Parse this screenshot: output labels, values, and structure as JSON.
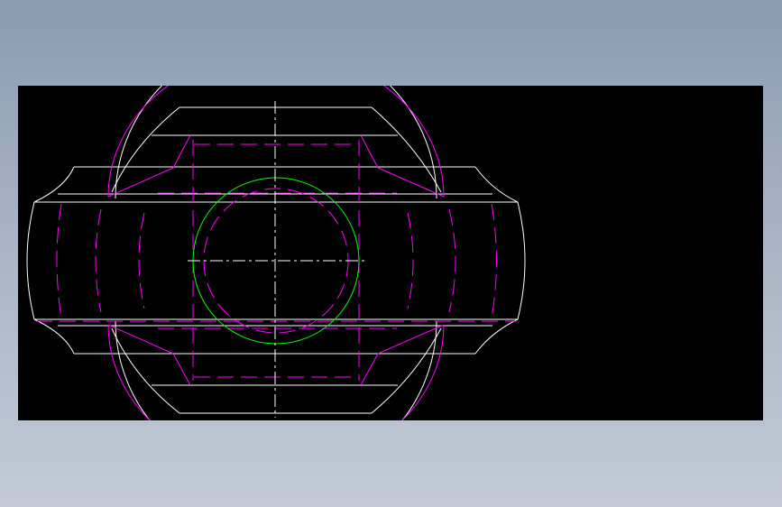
{
  "colors": {
    "background_outer": "#8a9bb0",
    "viewport_background": "#000000",
    "visible_edge": "#ffffff",
    "hidden_edge": "#ff00ff",
    "bore_circle": "#00ff00",
    "centerline": "#ffffff"
  },
  "drawing": {
    "view": "cad-front-view",
    "elements": [
      "outer-body-outline",
      "spherical-rim",
      "hidden-bore-lines",
      "bore-circle",
      "centerlines"
    ]
  }
}
